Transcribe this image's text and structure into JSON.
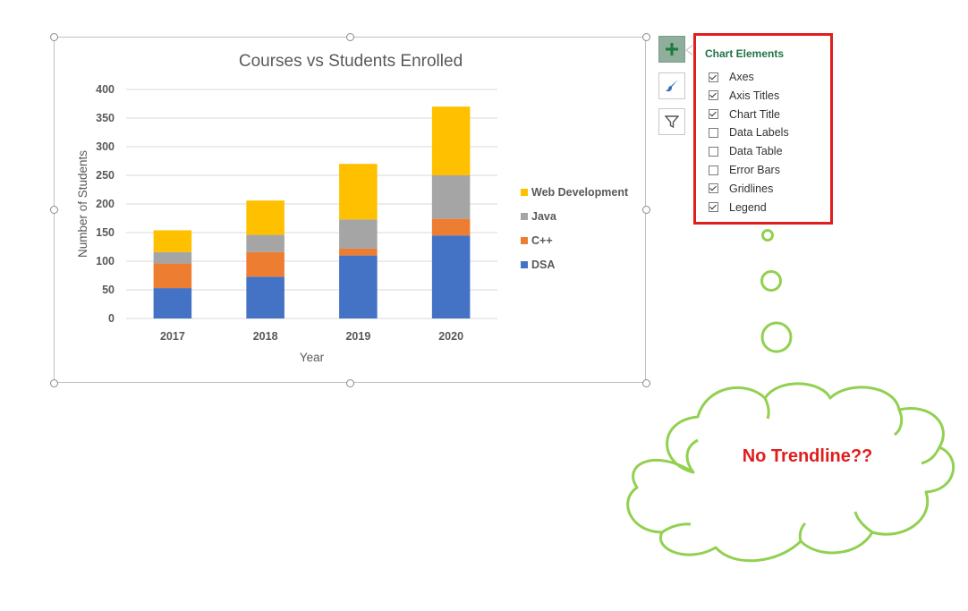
{
  "chart_data": {
    "type": "bar",
    "stacked": true,
    "title": "Courses vs Students Enrolled",
    "xlabel": "Year",
    "ylabel": "Number of Students",
    "categories": [
      "2017",
      "2018",
      "2019",
      "2020"
    ],
    "ylim": [
      0,
      400
    ],
    "yticks": [
      0,
      50,
      100,
      150,
      200,
      250,
      300,
      350,
      400
    ],
    "grid": true,
    "legend_position": "right",
    "series": [
      {
        "name": "DSA",
        "values": [
          53,
          73,
          110,
          145
        ],
        "color": "#4472c4"
      },
      {
        "name": "C++",
        "values": [
          43,
          43,
          12,
          29
        ],
        "color": "#ed7d31"
      },
      {
        "name": "Java",
        "values": [
          20,
          30,
          51,
          76
        ],
        "color": "#a5a5a5"
      },
      {
        "name": "Web Development",
        "values": [
          38,
          60,
          97,
          120
        ],
        "color": "#ffc000"
      }
    ]
  },
  "chart_buttons": {
    "elements_icon": "plus-icon",
    "styles_icon": "paintbrush-icon",
    "filters_icon": "funnel-icon"
  },
  "chart_elements_panel": {
    "title": "Chart Elements",
    "options": [
      {
        "label": "Axes",
        "checked": true
      },
      {
        "label": "Axis Titles",
        "checked": true
      },
      {
        "label": "Chart Title",
        "checked": true
      },
      {
        "label": "Data Labels",
        "checked": false
      },
      {
        "label": "Data Table",
        "checked": false
      },
      {
        "label": "Error Bars",
        "checked": false
      },
      {
        "label": "Gridlines",
        "checked": true
      },
      {
        "label": "Legend",
        "checked": true
      }
    ]
  },
  "thought_bubble": {
    "text": "No Trendline??",
    "text_color": "#e11d1d",
    "outline_color": "#92d050"
  },
  "colors": {
    "panel_border": "#e11d1d",
    "panel_title": "#217346"
  }
}
